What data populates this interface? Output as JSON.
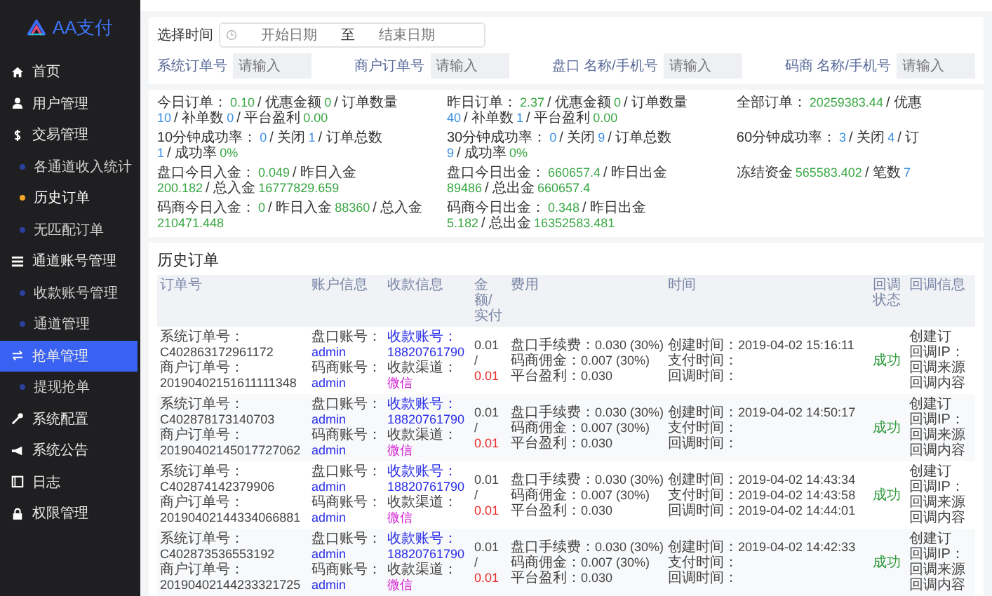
{
  "brand": {
    "name": "AA支付"
  },
  "sidebar": {
    "items": [
      {
        "label": "首页",
        "selected": false
      },
      {
        "label": "用户管理",
        "selected": false
      },
      {
        "label": "交易管理",
        "selected": false,
        "children": [
          {
            "label": "各通道收入统计",
            "selected": false
          },
          {
            "label": "历史订单",
            "selected": true
          },
          {
            "label": "无匹配订单",
            "selected": false
          }
        ]
      },
      {
        "label": "通道账号管理",
        "selected": false,
        "children": [
          {
            "label": "收款账号管理",
            "selected": false
          },
          {
            "label": "通道管理",
            "selected": false
          }
        ]
      },
      {
        "label": "抢单管理",
        "selected": true,
        "children": [
          {
            "label": "提现抢单",
            "selected": false
          }
        ]
      },
      {
        "label": "系统配置",
        "selected": false
      },
      {
        "label": "系统公告",
        "selected": false
      },
      {
        "label": "日志",
        "selected": false
      },
      {
        "label": "权限管理",
        "selected": false
      }
    ]
  },
  "filters": {
    "time_label": "选择时间",
    "start_placeholder": "开始日期",
    "range_separator": "至",
    "end_placeholder": "结束日期",
    "fields": [
      {
        "label": "系统订单号",
        "placeholder": "请输入"
      },
      {
        "label": "商户订单号",
        "placeholder": "请输入"
      },
      {
        "label": "盘口 名称/手机号",
        "placeholder": "请输入"
      },
      {
        "label": "码商 名称/手机号",
        "placeholder": "请输入"
      }
    ]
  },
  "stats": [
    {
      "segments": [
        {
          "text": "今日订单："
        },
        {
          "text": "0.10",
          "color": "#3aa845"
        },
        {
          "text": "/ 优惠金额"
        },
        {
          "text": "0",
          "color": "#3aa845"
        },
        {
          "text": "/ 订单数量"
        },
        {
          "text": "10",
          "color": "#3a8ee6"
        },
        {
          "text": "/ 补单数"
        },
        {
          "text": "0",
          "color": "#3a8ee6"
        },
        {
          "text": "/ 平台盈利"
        },
        {
          "text": "0.00",
          "color": "#3aa845"
        }
      ]
    },
    {
      "segments": [
        {
          "text": "昨日订单："
        },
        {
          "text": "2.37",
          "color": "#3aa845"
        },
        {
          "text": "/ 优惠金额"
        },
        {
          "text": "0",
          "color": "#3aa845"
        },
        {
          "text": "/ 订单数量"
        },
        {
          "text": "40",
          "color": "#3a8ee6"
        },
        {
          "text": "/ 补单数"
        },
        {
          "text": "1",
          "color": "#3a8ee6"
        },
        {
          "text": "/ 平台盈利"
        },
        {
          "text": "0.00",
          "color": "#3aa845"
        }
      ]
    },
    {
      "segments": [
        {
          "text": "全部订单："
        },
        {
          "text": "20259383.44",
          "color": "#3aa845"
        },
        {
          "text": "/ 优惠"
        }
      ]
    },
    {
      "segments": [
        {
          "text": "10分钟成功率："
        },
        {
          "text": "0",
          "color": "#3a8ee6"
        },
        {
          "text": "/ 关闭"
        },
        {
          "text": "1",
          "color": "#3a8ee6"
        },
        {
          "text": "/ 订单总数"
        },
        {
          "text": "1",
          "color": "#3a8ee6"
        },
        {
          "text": "/ 成功率"
        },
        {
          "text": "0%",
          "color": "#3aa845"
        }
      ]
    },
    {
      "segments": [
        {
          "text": "30分钟成功率："
        },
        {
          "text": "0",
          "color": "#3a8ee6"
        },
        {
          "text": "/ 关闭"
        },
        {
          "text": "9",
          "color": "#3a8ee6"
        },
        {
          "text": "/ 订单总数"
        },
        {
          "text": "9",
          "color": "#3a8ee6"
        },
        {
          "text": "/ 成功率"
        },
        {
          "text": "0%",
          "color": "#3aa845"
        }
      ]
    },
    {
      "segments": [
        {
          "text": "60分钟成功率："
        },
        {
          "text": "3",
          "color": "#3a8ee6"
        },
        {
          "text": "/ 关闭"
        },
        {
          "text": "4",
          "color": "#3a8ee6"
        },
        {
          "text": "/ 订"
        }
      ]
    },
    {
      "segments": [
        {
          "text": "盘口今日入金："
        },
        {
          "text": "0.049",
          "color": "#3aa845"
        },
        {
          "text": "/ 昨日入金"
        },
        {
          "text": "200.182",
          "color": "#3aa845"
        },
        {
          "text": "/ 总入金"
        },
        {
          "text": "16777829.659",
          "color": "#3aa845"
        }
      ]
    },
    {
      "segments": [
        {
          "text": "盘口今日出金："
        },
        {
          "text": "660657.4",
          "color": "#3aa845"
        },
        {
          "text": "/ 昨日出金"
        },
        {
          "text": "89486",
          "color": "#3aa845"
        },
        {
          "text": "/ 总出金"
        },
        {
          "text": "660657.4",
          "color": "#3aa845"
        }
      ]
    },
    {
      "segments": [
        {
          "text": "冻结资金"
        },
        {
          "text": "565583.402",
          "color": "#3aa845"
        },
        {
          "text": "/ 笔数"
        },
        {
          "text": "7",
          "color": "#3a8ee6"
        }
      ]
    },
    {
      "segments": [
        {
          "text": "码商今日入金："
        },
        {
          "text": "0",
          "color": "#3aa845"
        },
        {
          "text": "/ 昨日入金"
        },
        {
          "text": "88360",
          "color": "#3aa845"
        },
        {
          "text": "/ 总入金"
        },
        {
          "text": "210471.448",
          "color": "#3aa845"
        }
      ]
    },
    {
      "segments": [
        {
          "text": "码商今日出金："
        },
        {
          "text": "0.348",
          "color": "#3aa845"
        },
        {
          "text": "/ 昨日出金"
        },
        {
          "text": "5.182",
          "color": "#3aa845"
        },
        {
          "text": "/ 总出金"
        },
        {
          "text": "16352583.481",
          "color": "#3aa845"
        }
      ]
    }
  ],
  "table": {
    "title": "历史订单",
    "columns": [
      "订单号",
      "账户信息",
      "收款信息",
      "金额/实付",
      "费用",
      "时间",
      "回调状态",
      "回调信息"
    ],
    "rows": [
      {
        "order": [
          {
            "label": "系统订单号：",
            "value": "C402863172961172"
          },
          {
            "label": "商户订单号：",
            "value": "20190402151611111348"
          }
        ],
        "account": [
          {
            "label": "盘口账号：",
            "value": "admin"
          },
          {
            "label": "码商账号：",
            "value": "admin"
          }
        ],
        "payee": [
          {
            "label": "收款账号：",
            "value": "18820761790"
          },
          {
            "label": "收款渠道：",
            "value": "微信"
          }
        ],
        "amount": {
          "charged": "0.01",
          "separator": "/",
          "paid": "0.01"
        },
        "fees": [
          {
            "label": "盘口手续费：",
            "value": "0.030 (30%)"
          },
          {
            "label": "码商佣金：",
            "value": "0.007 (30%)"
          },
          {
            "label": "平台盈利：",
            "value": "0.030"
          }
        ],
        "times": [
          {
            "label": "创建时间：",
            "value": "2019-04-02 15:16:11"
          },
          {
            "label": "支付时间："
          },
          {
            "label": "回调时间："
          }
        ],
        "status": "成功",
        "callback": [
          "创建订",
          "回调IP：",
          "回调来源",
          "回调内容"
        ]
      },
      {
        "order": [
          {
            "label": "系统订单号：",
            "value": "C402878173140703"
          },
          {
            "label": "商户订单号：",
            "value": "20190402145017727062"
          }
        ],
        "account": [
          {
            "label": "盘口账号：",
            "value": "admin"
          },
          {
            "label": "码商账号：",
            "value": "admin"
          }
        ],
        "payee": [
          {
            "label": "收款账号：",
            "value": "18820761790"
          },
          {
            "label": "收款渠道：",
            "value": "微信"
          }
        ],
        "amount": {
          "charged": "0.01",
          "separator": "/",
          "paid": "0.01"
        },
        "fees": [
          {
            "label": "盘口手续费：",
            "value": "0.030 (30%)"
          },
          {
            "label": "码商佣金：",
            "value": "0.007 (30%)"
          },
          {
            "label": "平台盈利：",
            "value": "0.030"
          }
        ],
        "times": [
          {
            "label": "创建时间：",
            "value": "2019-04-02 14:50:17"
          },
          {
            "label": "支付时间："
          },
          {
            "label": "回调时间："
          }
        ],
        "status": "成功",
        "callback": [
          "创建订",
          "回调IP：",
          "回调来源",
          "回调内容"
        ]
      },
      {
        "order": [
          {
            "label": "系统订单号：",
            "value": "C402874142379906"
          },
          {
            "label": "商户订单号：",
            "value": "20190402144334066881"
          }
        ],
        "account": [
          {
            "label": "盘口账号：",
            "value": "admin"
          },
          {
            "label": "码商账号：",
            "value": "admin"
          }
        ],
        "payee": [
          {
            "label": "收款账号：",
            "value": "18820761790"
          },
          {
            "label": "收款渠道：",
            "value": "微信"
          }
        ],
        "amount": {
          "charged": "0.01",
          "separator": "/",
          "paid": "0.01"
        },
        "fees": [
          {
            "label": "盘口手续费：",
            "value": "0.030 (30%)"
          },
          {
            "label": "码商佣金：",
            "value": "0.007 (30%)"
          },
          {
            "label": "平台盈利：",
            "value": "0.030"
          }
        ],
        "times": [
          {
            "label": "创建时间：",
            "value": "2019-04-02 14:43:34"
          },
          {
            "label": "支付时间：",
            "value": "2019-04-02 14:43:58"
          },
          {
            "label": "回调时间：",
            "value": "2019-04-02 14:44:01"
          }
        ],
        "status": "成功",
        "callback": [
          "创建订",
          "回调IP：",
          "回调来源",
          "回调内容"
        ]
      },
      {
        "order": [
          {
            "label": "系统订单号：",
            "value": "C402873536553192"
          },
          {
            "label": "商户订单号：",
            "value": "20190402144233321725"
          }
        ],
        "account": [
          {
            "label": "盘口账号：",
            "value": "admin"
          },
          {
            "label": "码商账号：",
            "value": "admin"
          }
        ],
        "payee": [
          {
            "label": "收款账号：",
            "value": "18820761790"
          },
          {
            "label": "收款渠道：",
            "value": "微信"
          }
        ],
        "amount": {
          "charged": "0.01",
          "separator": "/",
          "paid": "0.01"
        },
        "fees": [
          {
            "label": "盘口手续费：",
            "value": "0.030 (30%)"
          },
          {
            "label": "码商佣金：",
            "value": "0.007 (30%)"
          },
          {
            "label": "平台盈利：",
            "value": "0.030"
          }
        ],
        "times": [
          {
            "label": "创建时间：",
            "value": "2019-04-02 14:42:33"
          },
          {
            "label": "支付时间："
          },
          {
            "label": "回调时间："
          }
        ],
        "status": "成功",
        "callback": [
          "创建订",
          "回调IP：",
          "回调来源",
          "回调内容"
        ]
      }
    ]
  }
}
